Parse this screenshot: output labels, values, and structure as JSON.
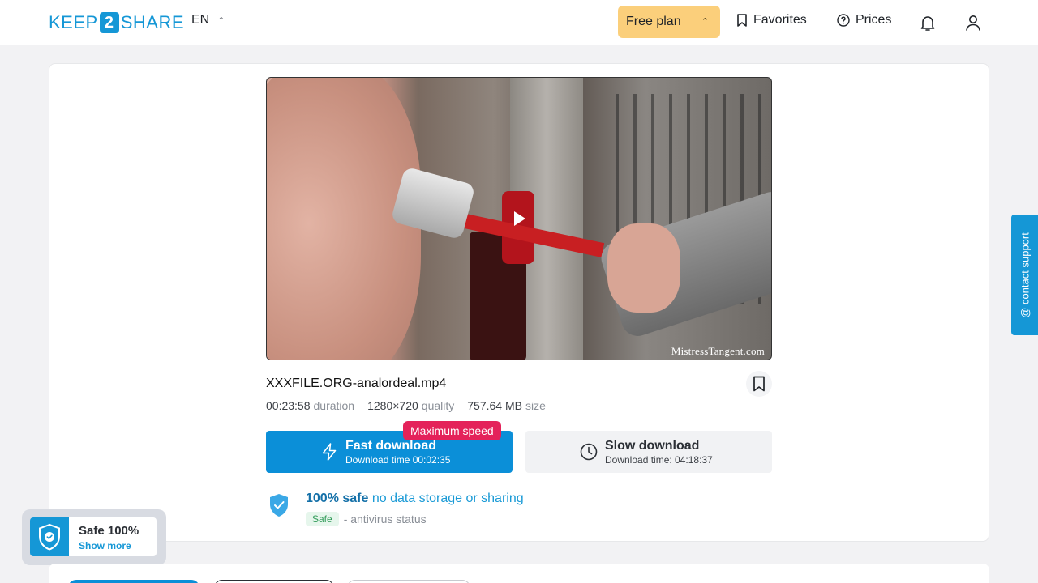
{
  "header": {
    "logo_pre": "KEEP",
    "logo_num": "2",
    "logo_post": "SHARE",
    "language": "EN",
    "plan_label": "Free plan",
    "favorites_label": "Favorites",
    "prices_label": "Prices"
  },
  "file": {
    "name": "XXXFILE.ORG-analordeal.mp4",
    "duration_value": "00:23:58",
    "duration_label": "duration",
    "quality_value": "1280×720",
    "quality_label": "quality",
    "size_value": "757.64 MB",
    "size_label": "size",
    "watermark": "MistressTangent.com"
  },
  "download": {
    "badge": "Maximum speed",
    "fast_title": "Fast download",
    "fast_sub": "Download time 00:02:35",
    "slow_title": "Slow download",
    "slow_sub": "Download time: 04:18:37"
  },
  "safety": {
    "strong": "100% safe",
    "rest": "no data storage or sharing",
    "tag": "Safe",
    "status": "- antivirus status"
  },
  "support": {
    "label": "@ contact support"
  },
  "safe_widget": {
    "title": "Safe 100%",
    "link": "Show more"
  },
  "colors": {
    "brand": "#1597d6",
    "fast_button": "#0b8fd8",
    "plan_button": "#fbcf7b",
    "badge": "#e4225a"
  },
  "icons": [
    "bookmark-icon",
    "help-circle-icon",
    "bell-icon",
    "user-icon",
    "bolt-icon",
    "clock-icon",
    "shield-check-icon",
    "play-icon"
  ]
}
